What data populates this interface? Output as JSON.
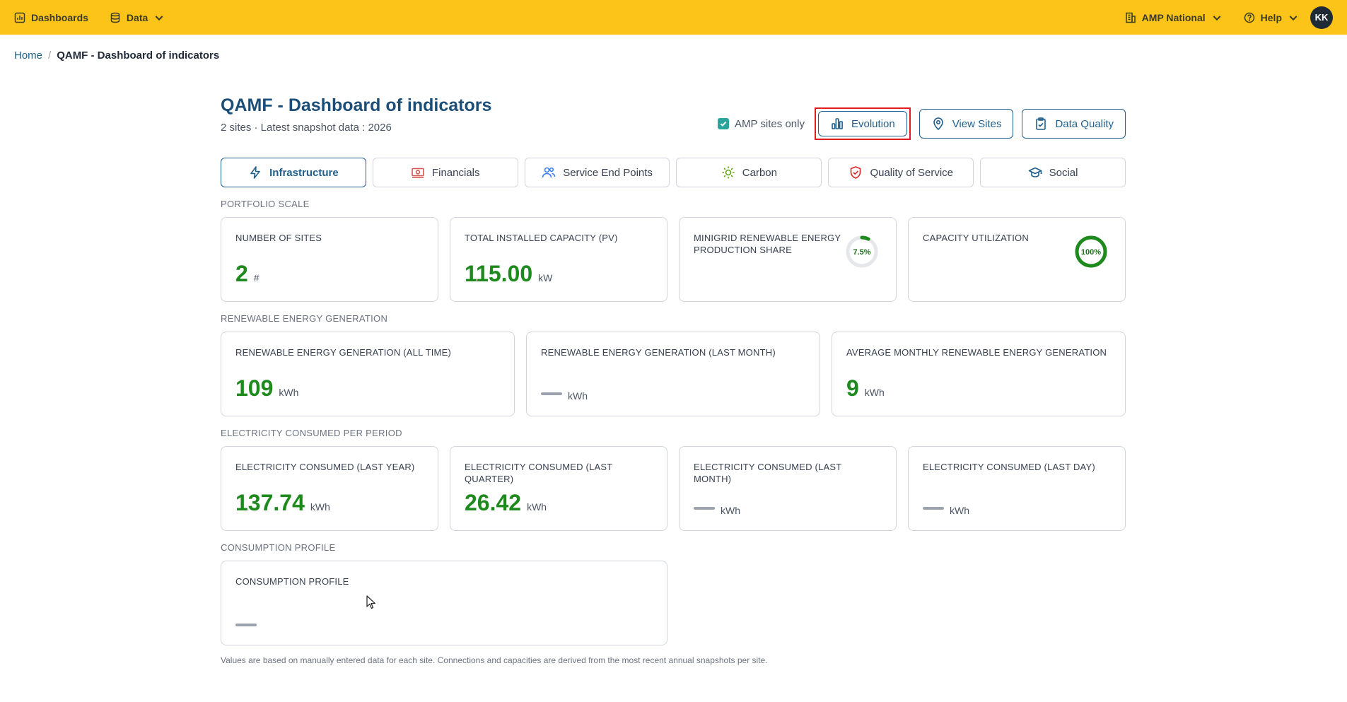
{
  "topbar": {
    "dashboards": "Dashboards",
    "data": "Data",
    "org": "AMP National",
    "help": "Help",
    "avatar": "KK",
    "accent": "#fcc419"
  },
  "breadcrumb": {
    "home": "Home",
    "sep": "/",
    "current": "QAMF - Dashboard of indicators"
  },
  "header": {
    "title": "QAMF - Dashboard of indicators",
    "subtitle": "2 sites · Latest snapshot data : 2026",
    "amp_only": "AMP sites only",
    "evolution": "Evolution",
    "view_sites": "View Sites",
    "data_quality": "Data Quality"
  },
  "tabs": [
    {
      "label": "Infrastructure",
      "icon": "lightning-icon"
    },
    {
      "label": "Financials",
      "icon": "money-icon"
    },
    {
      "label": "Service End Points",
      "icon": "users-icon"
    },
    {
      "label": "Carbon",
      "icon": "sun-icon"
    },
    {
      "label": "Quality of Service",
      "icon": "shield-check-icon"
    },
    {
      "label": "Social",
      "icon": "graduation-cap-icon"
    }
  ],
  "sections": {
    "portfolio": "PORTFOLIO SCALE",
    "generation": "RENEWABLE ENERGY GENERATION",
    "consumed": "ELECTRICITY CONSUMED PER PERIOD",
    "profile": "CONSUMPTION PROFILE"
  },
  "portfolio": {
    "sites_label": "NUMBER OF SITES",
    "sites_value": "2",
    "sites_unit": "#",
    "capacity_label": "TOTAL INSTALLED CAPACITY (PV)",
    "capacity_value": "115.00",
    "capacity_unit": "kW",
    "share_label": "MINIGRID RENEWABLE ENERGY PRODUCTION SHARE",
    "share_value": "7.5%",
    "share_fraction": 0.075,
    "utilization_label": "CAPACITY UTILIZATION",
    "utilization_value": "100%",
    "utilization_fraction": 1.0
  },
  "generation": {
    "all_time_label": "RENEWABLE ENERGY GENERATION (ALL TIME)",
    "all_time_value": "109",
    "all_time_unit": "kWh",
    "last_month_label": "RENEWABLE ENERGY GENERATION (LAST MONTH)",
    "last_month_unit": "kWh",
    "avg_label": "AVERAGE MONTHLY RENEWABLE ENERGY GENERATION",
    "avg_value": "9",
    "avg_unit": "kWh"
  },
  "consumed": {
    "year_label": "ELECTRICITY CONSUMED (LAST YEAR)",
    "year_value": "137.74",
    "year_unit": "kWh",
    "quarter_label": "ELECTRICITY CONSUMED (LAST QUARTER)",
    "quarter_value": "26.42",
    "quarter_unit": "kWh",
    "month_label": "ELECTRICITY CONSUMED (LAST MONTH)",
    "month_unit": "kWh",
    "day_label": "ELECTRICITY CONSUMED (LAST DAY)",
    "day_unit": "kWh"
  },
  "profile": {
    "label": "CONSUMPTION PROFILE"
  },
  "footnote": "Values are based on manually entered data for each site. Connections and capacities are derived from the most recent annual snapshots per site."
}
